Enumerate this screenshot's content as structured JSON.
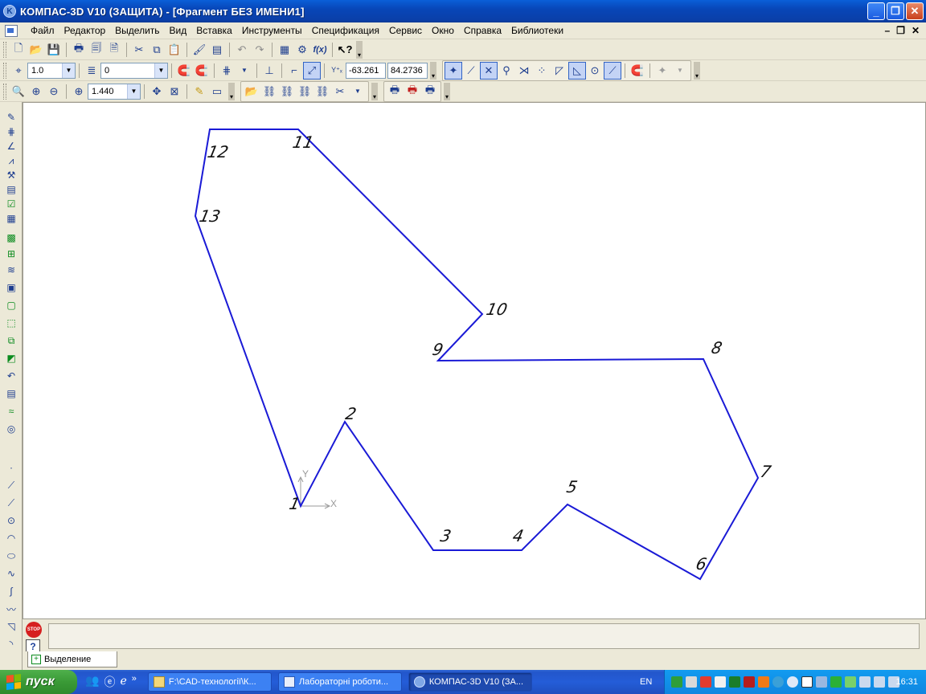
{
  "window": {
    "title": "КОМПАС-3D V10 (ЗАЩИТА) - [Фрагмент БЕЗ ИМЕНИ1]",
    "logo": "K"
  },
  "menu": {
    "items": [
      "Файл",
      "Редактор",
      "Выделить",
      "Вид",
      "Вставка",
      "Инструменты",
      "Спецификация",
      "Сервис",
      "Окно",
      "Справка",
      "Библиотеки"
    ]
  },
  "toolbar2": {
    "step": "1.0",
    "layer": "0",
    "coord_x": "-63.261",
    "coord_y": "84.2736"
  },
  "toolbar3": {
    "zoom": "1.440"
  },
  "drawing": {
    "stroke_color": "#1a1ad6",
    "axis_labels": {
      "x": "X",
      "y": "Y"
    },
    "vertices": [
      {
        "label": "1"
      },
      {
        "label": "2"
      },
      {
        "label": "3"
      },
      {
        "label": "4"
      },
      {
        "label": "5"
      },
      {
        "label": "6"
      },
      {
        "label": "7"
      },
      {
        "label": "8"
      },
      {
        "label": "9"
      },
      {
        "label": "10"
      },
      {
        "label": "11"
      },
      {
        "label": "12"
      },
      {
        "label": "13"
      }
    ]
  },
  "bottom": {
    "stop_label": "STOP",
    "help_label": "?",
    "tab_label": "Выделение"
  },
  "taskbar": {
    "start_label": "пуск",
    "tasks": [
      "F:\\CAD-технології\\К...",
      "Лабораторні роботи...",
      "КОМПАС-3D V10 (ЗА..."
    ],
    "lang": "EN",
    "time": "16:31"
  }
}
